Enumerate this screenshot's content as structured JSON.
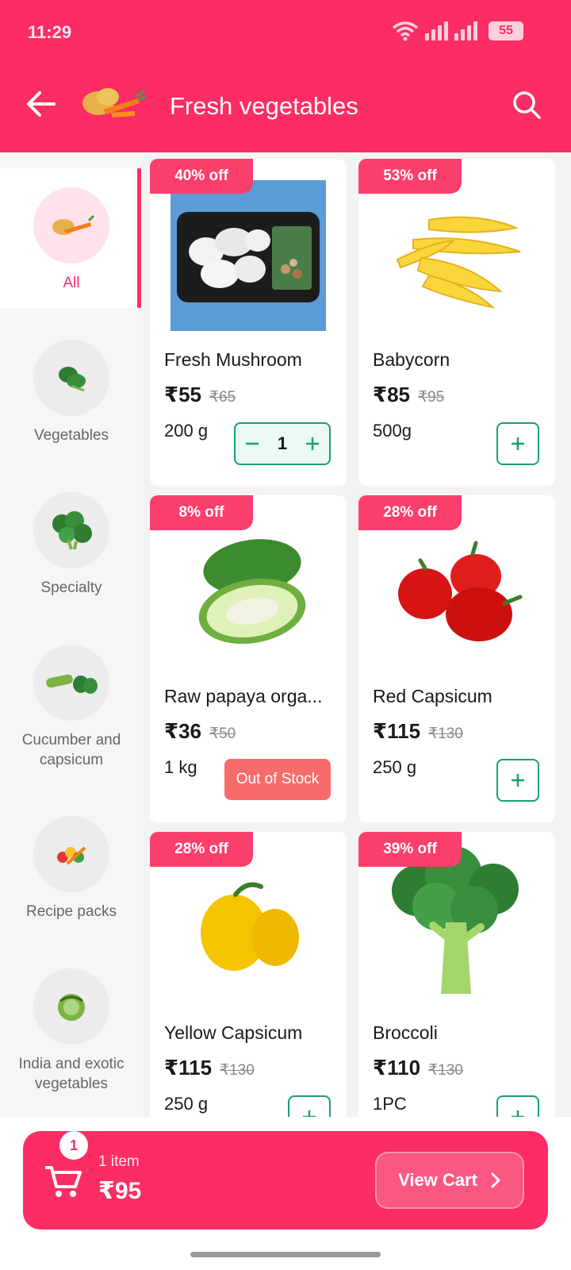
{
  "status_bar": {
    "time": "11:29",
    "battery": "55"
  },
  "header": {
    "title": "Fresh vegetables",
    "bg_color": "#fb2d64"
  },
  "sidebar": {
    "items": [
      {
        "label": "All",
        "active": true
      },
      {
        "label": "Vegetables"
      },
      {
        "label": "Specialty"
      },
      {
        "label": "Cucumber and capsicum"
      },
      {
        "label": "Recipe packs"
      },
      {
        "label": "India and exotic vegetables"
      }
    ]
  },
  "products": [
    {
      "badge": "40% off",
      "name": "Fresh Mushroom",
      "price": "₹55",
      "mrp": "₹65",
      "weight": "200 g",
      "qty": "1",
      "state": "in-cart"
    },
    {
      "badge": "53% off",
      "name": "Babycorn",
      "price": "₹85",
      "mrp": "₹95",
      "weight": "500g",
      "state": "add"
    },
    {
      "badge": "8% off",
      "name": "Raw papaya orga...",
      "price": "₹36",
      "mrp": "₹50",
      "weight": "1 kg",
      "state": "out-of-stock",
      "oos_label": "Out of Stock"
    },
    {
      "badge": "28% off",
      "name": "Red Capsicum",
      "price": "₹115",
      "mrp": "₹130",
      "weight": "250 g",
      "state": "add"
    },
    {
      "badge": "28% off",
      "name": "Yellow Capsicum",
      "price": "₹115",
      "mrp": "₹130",
      "weight": "250 g",
      "state": "add"
    },
    {
      "badge": "39% off",
      "name": "Broccoli",
      "price": "₹110",
      "mrp": "₹130",
      "weight": "1PC",
      "state": "add"
    }
  ],
  "cart": {
    "count": "1",
    "items_label": "1 item",
    "total": "₹95",
    "cta": "View Cart"
  },
  "colors": {
    "accent": "#fb2d64",
    "green": "#1aa06d",
    "oos": "#f96b6b"
  }
}
